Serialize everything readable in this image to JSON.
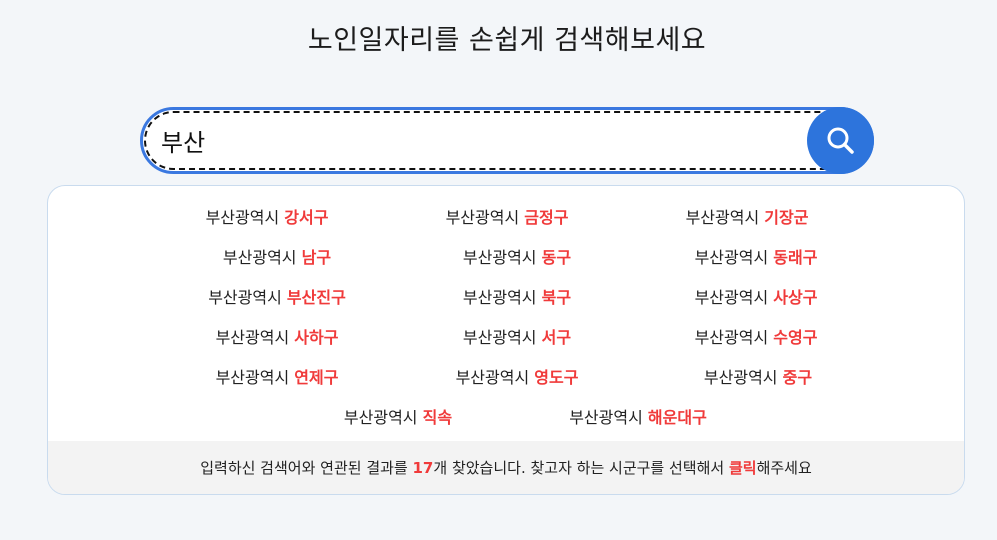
{
  "page_title": "노인일자리를 손쉽게 검색해보세요",
  "search": {
    "value": "부산",
    "button_icon": "search-icon",
    "accent_color": "#2d74dc"
  },
  "results": [
    {
      "city": "부산광역시",
      "district": "강서구"
    },
    {
      "city": "부산광역시",
      "district": "금정구"
    },
    {
      "city": "부산광역시",
      "district": "기장군"
    },
    {
      "city": "부산광역시",
      "district": "남구"
    },
    {
      "city": "부산광역시",
      "district": "동구"
    },
    {
      "city": "부산광역시",
      "district": "동래구"
    },
    {
      "city": "부산광역시",
      "district": "부산진구"
    },
    {
      "city": "부산광역시",
      "district": "북구"
    },
    {
      "city": "부산광역시",
      "district": "사상구"
    },
    {
      "city": "부산광역시",
      "district": "사하구"
    },
    {
      "city": "부산광역시",
      "district": "서구"
    },
    {
      "city": "부산광역시",
      "district": "수영구"
    },
    {
      "city": "부산광역시",
      "district": "연제구"
    },
    {
      "city": "부산광역시",
      "district": "영도구"
    },
    {
      "city": "부산광역시",
      "district": "중구"
    },
    {
      "city": "부산광역시",
      "district": "직속"
    },
    {
      "city": "부산광역시",
      "district": "해운대구"
    }
  ],
  "summary": {
    "prefix": "입력하신 검색어와 연관된 결과를 ",
    "count": "17",
    "middle": "개 찾았습니다. 찾고자 하는 시군구를 선택해서 ",
    "highlight": "클릭",
    "suffix": "해주세요"
  },
  "colors": {
    "highlight": "#f03a3a",
    "background": "#f3f6f9"
  }
}
